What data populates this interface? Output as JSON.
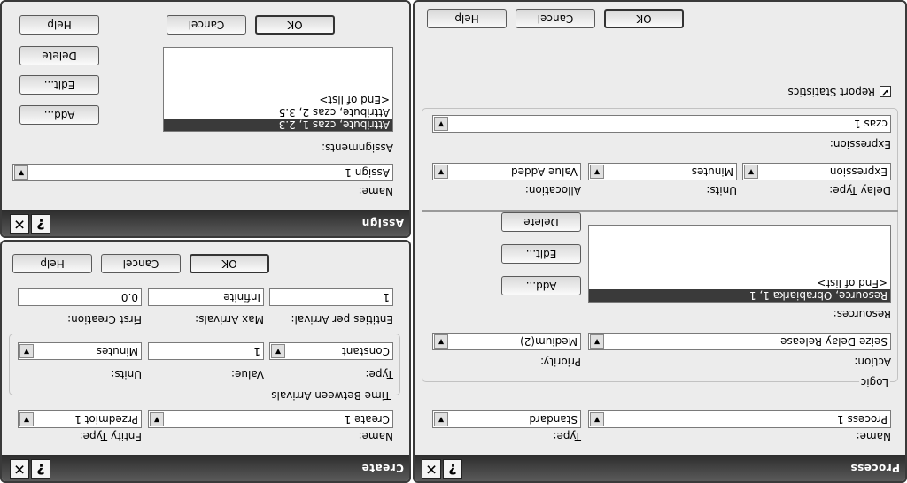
{
  "common": {
    "ok": "OK",
    "cancel": "Cancel",
    "help": "Help",
    "add": "Add...",
    "edit": "Edit...",
    "delete": "Delete",
    "help_glyph": "?",
    "close_glyph": "✕",
    "combo_glyph": "▼",
    "end_of_list": "<End of list>"
  },
  "create": {
    "title": "Create",
    "name_label": "Name:",
    "name_value": "Create 1",
    "entity_type_label": "Entity Type:",
    "entity_type_value": "Przedmiot 1",
    "tba_group": "Time Between Arrivals",
    "type_label": "Type:",
    "type_value": "Constant",
    "value_label": "Value:",
    "value_value": "1",
    "units_label": "Units:",
    "units_value": "Minutes",
    "entities_label": "Entities per Arrival:",
    "entities_value": "1",
    "max_label": "Max Arrivals:",
    "max_value": "Infinite",
    "first_label": "First Creation:",
    "first_value": "0.0"
  },
  "assign": {
    "title": "Assign",
    "name_label": "Name:",
    "name_value": "Assign 1",
    "assignments_label": "Assignments:",
    "items": [
      "Attribute, czas 1, 2.3",
      "Attribute, czas 2, 3.5"
    ]
  },
  "process": {
    "title": "Process",
    "name_label": "Name:",
    "name_value": "Process 1",
    "type_label": "Type:",
    "type_value": "Standard",
    "logic_group": "Logic",
    "action_label": "Action:",
    "action_value": "Seize Delay Release",
    "priority_label": "Priority:",
    "priority_value": "Medium(2)",
    "resources_label": "Resources:",
    "resources": [
      "Resource, Obrabiarka 1, 1"
    ],
    "delay_type_label": "Delay Type:",
    "delay_type_value": "Expression",
    "units_label": "Units:",
    "units_value": "Minutes",
    "allocation_label": "Allocation:",
    "allocation_value": "Value Added",
    "expression_label": "Expression:",
    "expression_value": "czas 1",
    "report_label": "Report Statistics",
    "report_checked": "✔"
  }
}
